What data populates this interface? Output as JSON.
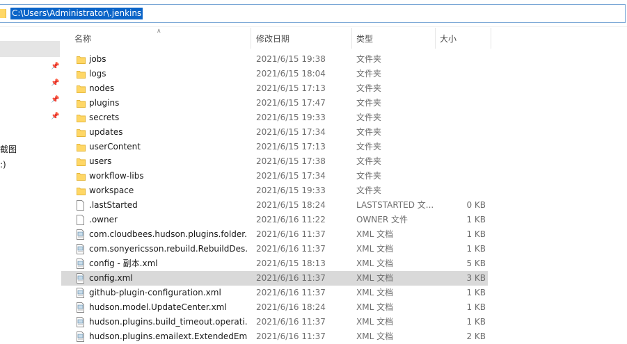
{
  "address": {
    "path": "C:\\Users\\Administrator\\.jenkins"
  },
  "nav": {
    "labels": [
      "截图",
      ":)"
    ]
  },
  "columns": {
    "name": "名称",
    "date": "修改日期",
    "type": "类型",
    "size": "大小"
  },
  "files": [
    {
      "name": "jobs",
      "date": "2021/6/15 19:38",
      "type": "文件夹",
      "size": "",
      "icon": "folder-icon"
    },
    {
      "name": "logs",
      "date": "2021/6/15 18:04",
      "type": "文件夹",
      "size": "",
      "icon": "folder-icon"
    },
    {
      "name": "nodes",
      "date": "2021/6/15 17:13",
      "type": "文件夹",
      "size": "",
      "icon": "folder-icon"
    },
    {
      "name": "plugins",
      "date": "2021/6/15 17:47",
      "type": "文件夹",
      "size": "",
      "icon": "folder-icon"
    },
    {
      "name": "secrets",
      "date": "2021/6/15 19:33",
      "type": "文件夹",
      "size": "",
      "icon": "folder-icon"
    },
    {
      "name": "updates",
      "date": "2021/6/15 17:34",
      "type": "文件夹",
      "size": "",
      "icon": "folder-icon"
    },
    {
      "name": "userContent",
      "date": "2021/6/15 17:13",
      "type": "文件夹",
      "size": "",
      "icon": "folder-icon"
    },
    {
      "name": "users",
      "date": "2021/6/15 17:38",
      "type": "文件夹",
      "size": "",
      "icon": "folder-icon"
    },
    {
      "name": "workflow-libs",
      "date": "2021/6/15 17:34",
      "type": "文件夹",
      "size": "",
      "icon": "folder-icon"
    },
    {
      "name": "workspace",
      "date": "2021/6/15 19:33",
      "type": "文件夹",
      "size": "",
      "icon": "folder-icon"
    },
    {
      "name": ".lastStarted",
      "date": "2021/6/15 18:24",
      "type": "LASTSTARTED 文...",
      "size": "0 KB",
      "icon": "file-icon"
    },
    {
      "name": ".owner",
      "date": "2021/6/16 11:22",
      "type": "OWNER 文件",
      "size": "1 KB",
      "icon": "file-icon"
    },
    {
      "name": "com.cloudbees.hudson.plugins.folder...",
      "date": "2021/6/16 11:37",
      "type": "XML 文档",
      "size": "1 KB",
      "icon": "xml-file-icon"
    },
    {
      "name": "com.sonyericsson.rebuild.RebuildDes...",
      "date": "2021/6/16 11:37",
      "type": "XML 文档",
      "size": "1 KB",
      "icon": "xml-file-icon"
    },
    {
      "name": "config - 副本.xml",
      "date": "2021/6/15 18:13",
      "type": "XML 文档",
      "size": "5 KB",
      "icon": "xml-file-icon"
    },
    {
      "name": "config.xml",
      "date": "2021/6/16 11:37",
      "type": "XML 文档",
      "size": "3 KB",
      "icon": "xml-file-icon",
      "selected": true
    },
    {
      "name": "github-plugin-configuration.xml",
      "date": "2021/6/16 11:37",
      "type": "XML 文档",
      "size": "1 KB",
      "icon": "xml-file-icon"
    },
    {
      "name": "hudson.model.UpdateCenter.xml",
      "date": "2021/6/16 18:24",
      "type": "XML 文档",
      "size": "1 KB",
      "icon": "xml-file-icon"
    },
    {
      "name": "hudson.plugins.build_timeout.operati...",
      "date": "2021/6/16 11:37",
      "type": "XML 文档",
      "size": "1 KB",
      "icon": "xml-file-icon"
    },
    {
      "name": "hudson.plugins.emailext.ExtendedEm...",
      "date": "2021/6/16 11:37",
      "type": "XML 文档",
      "size": "2 KB",
      "icon": "xml-file-icon"
    }
  ],
  "colors": {
    "selection_bg": "#d9d9d9",
    "address_highlight": "#0a64c8",
    "folder_yellow": "#ffd766"
  }
}
